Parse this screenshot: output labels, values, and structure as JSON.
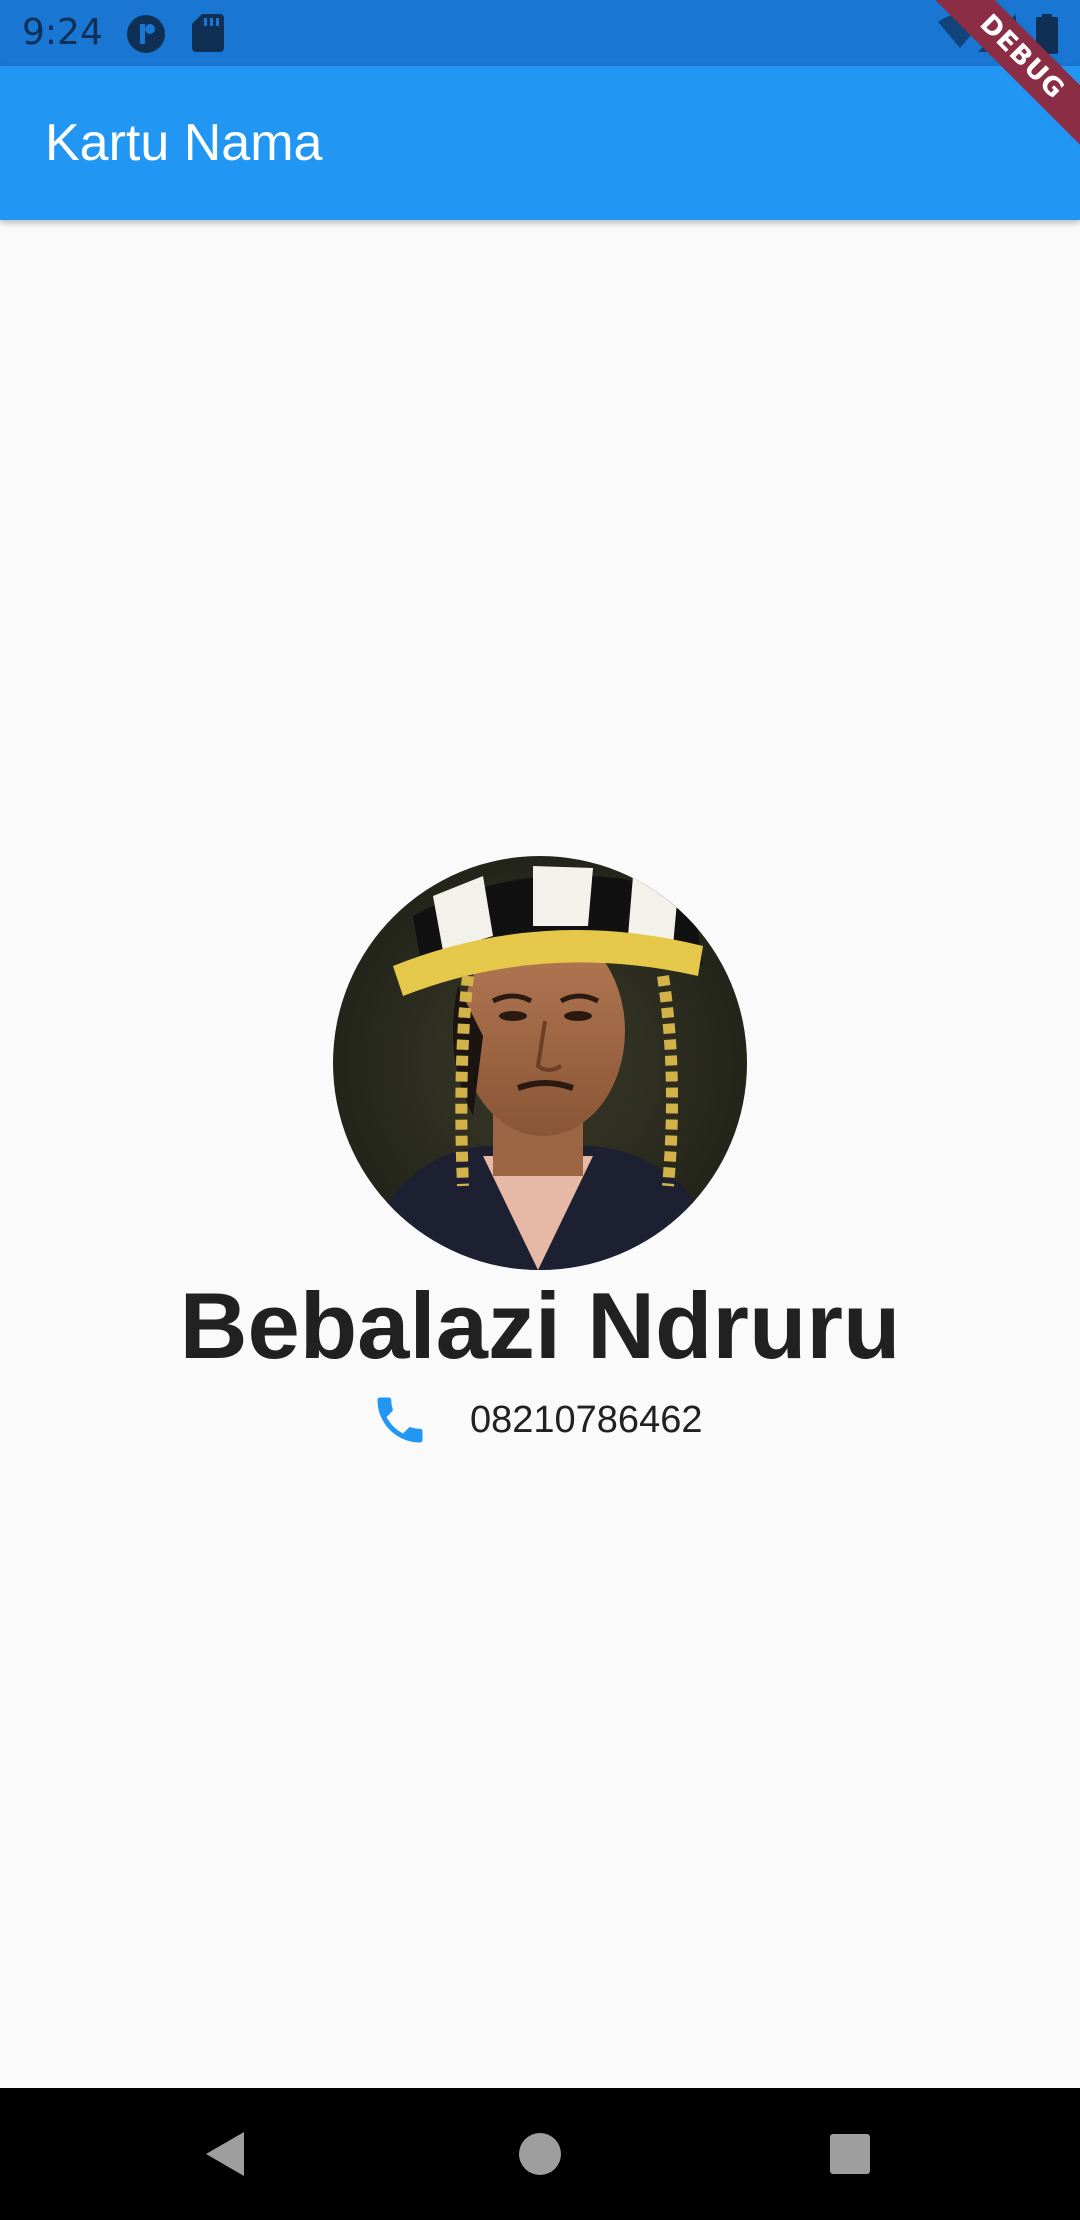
{
  "status_bar": {
    "time": "9:24",
    "debug_label": "DEBUG"
  },
  "app_bar": {
    "title": "Kartu Nama"
  },
  "profile": {
    "name": "Bebalazi Ndruru",
    "phone": "08210786462"
  },
  "colors": {
    "primary": "#2196F3",
    "status_bar": "#1976D2",
    "phone_icon": "#2196F3",
    "name_text": "#212121",
    "background": "#FAFAFA"
  },
  "icons": {
    "phone": "phone-icon",
    "back": "back-icon",
    "home": "home-icon",
    "recents": "recents-icon"
  }
}
